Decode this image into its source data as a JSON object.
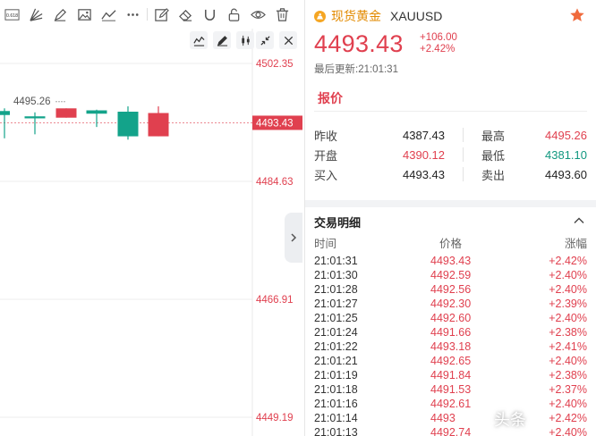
{
  "toolbar": {
    "tools": [
      "fib-icon",
      "fan-icon",
      "brush-icon",
      "image-icon",
      "trend-icon",
      "more-icon",
      "note-icon",
      "eraser-icon",
      "magnet-icon",
      "lock-icon",
      "eye-icon",
      "trash-icon"
    ],
    "fib_label": "0.618"
  },
  "chart_tools": [
    "indicator-icon",
    "draw-icon",
    "candle-type-icon"
  ],
  "chart_tools_right": [
    "collapse-icon",
    "close-icon"
  ],
  "chart_data": {
    "type": "candlestick",
    "y_ticks": [
      "4502.35",
      "4484.63",
      "4466.91",
      "4449.19"
    ],
    "y_tick_values": [
      4502.35,
      4484.63,
      4466.91,
      4449.19
    ],
    "current_price_label": "4493.43",
    "current_price": 4493.43,
    "high_marker_label": "4495.26",
    "high_marker": 4495.26,
    "candles": [
      {
        "open": 4494.6,
        "close": 4495.2,
        "high": 4495.6,
        "low": 4491.1
      },
      {
        "open": 4494.1,
        "close": 4494.4,
        "high": 4495.0,
        "low": 4491.7
      },
      {
        "open": 4494.2,
        "close": 4495.6,
        "high": 4495.6,
        "low": 4494.2
      },
      {
        "open": 4494.8,
        "close": 4495.3,
        "high": 4495.4,
        "low": 4492.8
      },
      {
        "open": 4495.1,
        "close": 4491.4,
        "high": 4495.9,
        "low": 4490.9
      },
      {
        "open": 4491.4,
        "close": 4494.9,
        "high": 4495.9,
        "low": 4491.4
      }
    ],
    "colors": {
      "up": "#e0404f",
      "down": "#13a38a"
    }
  },
  "panel": {
    "name": "现货黄金",
    "symbol": "XAUUSD",
    "price": "4493.43",
    "change": "+106.00",
    "change_pct": "+2.42%",
    "update_label": "最后更新:21:01:31",
    "tab_quote": "报价",
    "quote": {
      "rows": [
        {
          "l1": "昨收",
          "v1": "4387.43",
          "c1": "neutral",
          "l2": "最高",
          "v2": "4495.26",
          "c2": "red"
        },
        {
          "l1": "开盘",
          "v1": "4390.12",
          "c1": "red",
          "l2": "最低",
          "v2": "4381.10",
          "c2": "green"
        },
        {
          "l1": "买入",
          "v1": "4493.43",
          "c1": "neutral",
          "l2": "卖出",
          "v2": "4493.60",
          "c2": "neutral"
        }
      ]
    },
    "trades_title": "交易明细",
    "trades_header": {
      "time": "时间",
      "price": "价格",
      "change": "涨幅"
    },
    "trades": [
      {
        "time": "21:01:31",
        "price": "4493.43",
        "change": "+2.42%"
      },
      {
        "time": "21:01:30",
        "price": "4492.59",
        "change": "+2.40%"
      },
      {
        "time": "21:01:28",
        "price": "4492.56",
        "change": "+2.40%"
      },
      {
        "time": "21:01:27",
        "price": "4492.30",
        "change": "+2.39%"
      },
      {
        "time": "21:01:25",
        "price": "4492.60",
        "change": "+2.40%"
      },
      {
        "time": "21:01:24",
        "price": "4491.66",
        "change": "+2.38%"
      },
      {
        "time": "21:01:22",
        "price": "4493.18",
        "change": "+2.41%"
      },
      {
        "time": "21:01:21",
        "price": "4492.65",
        "change": "+2.40%"
      },
      {
        "time": "21:01:19",
        "price": "4491.84",
        "change": "+2.38%"
      },
      {
        "time": "21:01:18",
        "price": "4491.53",
        "change": "+2.37%"
      },
      {
        "time": "21:01:16",
        "price": "4492.61",
        "change": "+2.40%"
      },
      {
        "time": "21:01:14",
        "price": "4493",
        "change": "+2.42%"
      },
      {
        "time": "21:01:13",
        "price": "4492.74",
        "change": "+2.40%"
      }
    ]
  },
  "watermark": "头条"
}
